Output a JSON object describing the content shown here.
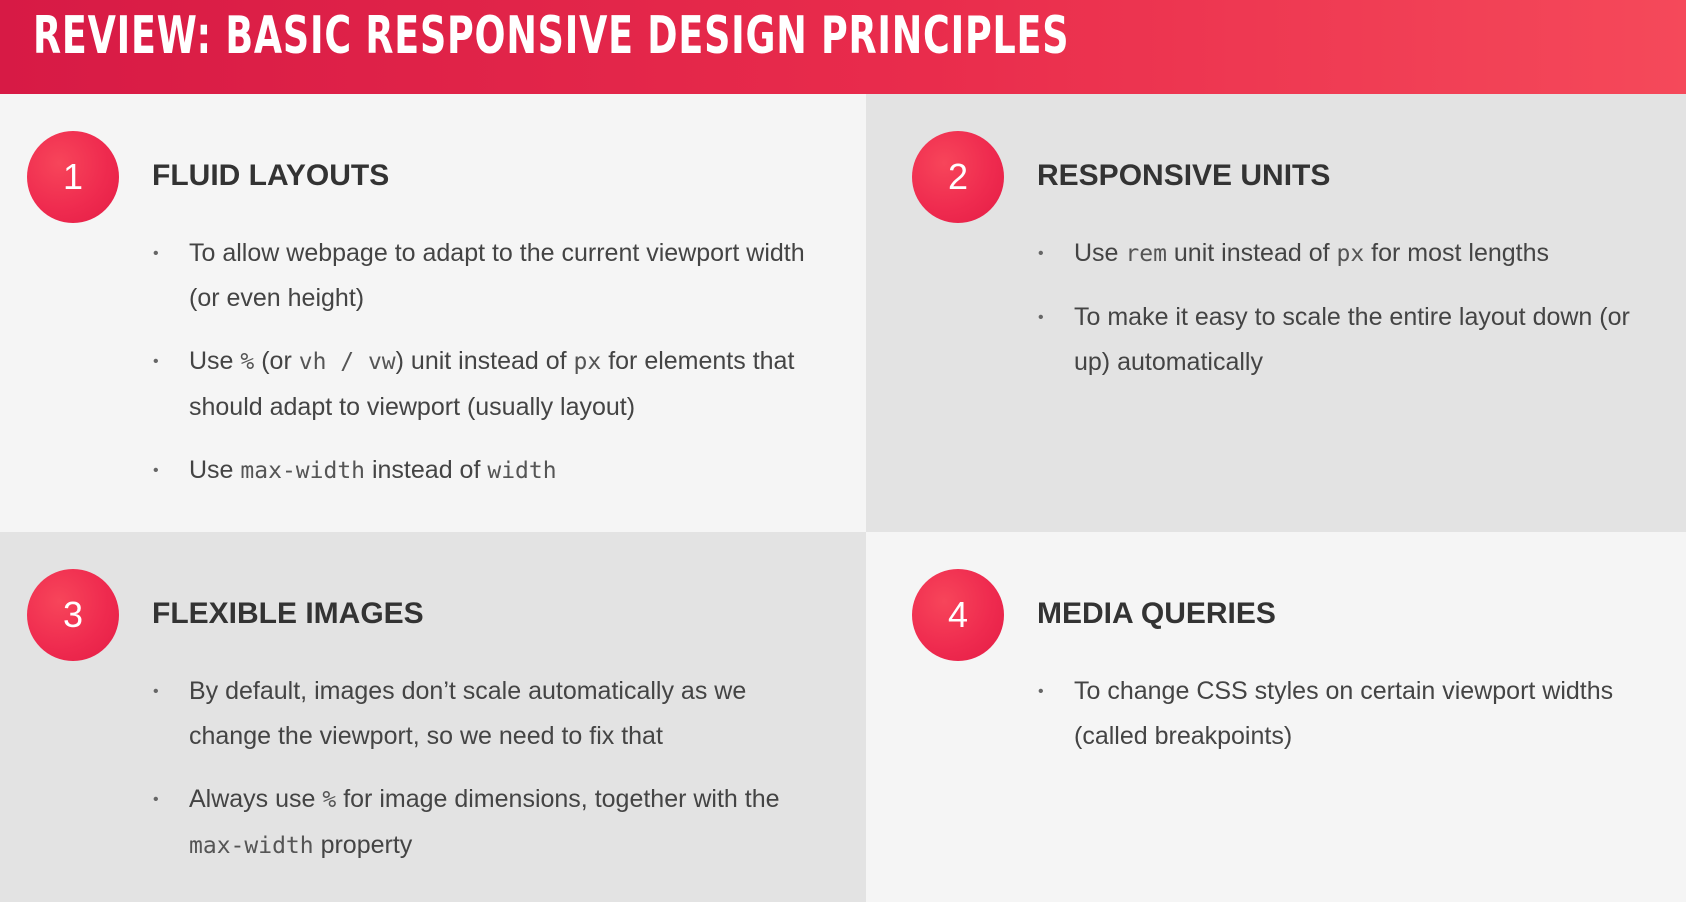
{
  "header": {
    "title": "REVIEW: BASIC RESPONSIVE DESIGN PRINCIPLES"
  },
  "sections": [
    {
      "number": "1",
      "title": "FLUID LAYOUTS",
      "bullets": [
        {
          "parts": [
            "To allow webpage to adapt to the current viewport width (or even height)"
          ]
        },
        {
          "parts": [
            "Use ",
            "%",
            " (or ",
            "vh / vw",
            ") unit instead of ",
            "px",
            " for elements that should adapt to viewport (usually layout)"
          ]
        },
        {
          "parts": [
            "Use ",
            "max-width",
            " instead of ",
            "width"
          ]
        }
      ]
    },
    {
      "number": "2",
      "title": "RESPONSIVE UNITS",
      "bullets": [
        {
          "parts": [
            "Use ",
            "rem",
            " unit instead of ",
            "px",
            " for most lengths"
          ]
        },
        {
          "parts": [
            "To make it easy to scale the entire layout down (or up) automatically"
          ]
        }
      ]
    },
    {
      "number": "3",
      "title": "FLEXIBLE IMAGES",
      "bullets": [
        {
          "parts": [
            "By default, images don’t scale automatically as we change the viewport, so we need to fix that"
          ]
        },
        {
          "parts": [
            "Always use ",
            "%",
            " for image dimensions, together with the ",
            "max-width",
            " property"
          ]
        }
      ]
    },
    {
      "number": "4",
      "title": "MEDIA QUERIES",
      "bullets": [
        {
          "parts": [
            "To change CSS styles on certain viewport widths (called breakpoints)"
          ]
        }
      ]
    }
  ],
  "bullet_glyph": "•",
  "colors": {
    "accent": "#ef2b4f",
    "header_start": "#d71a45",
    "header_end": "#f5495a",
    "panel_light": "#f5f5f5",
    "panel_dark": "#e3e3e3",
    "heading_text": "#333333",
    "body_text": "#444444"
  }
}
